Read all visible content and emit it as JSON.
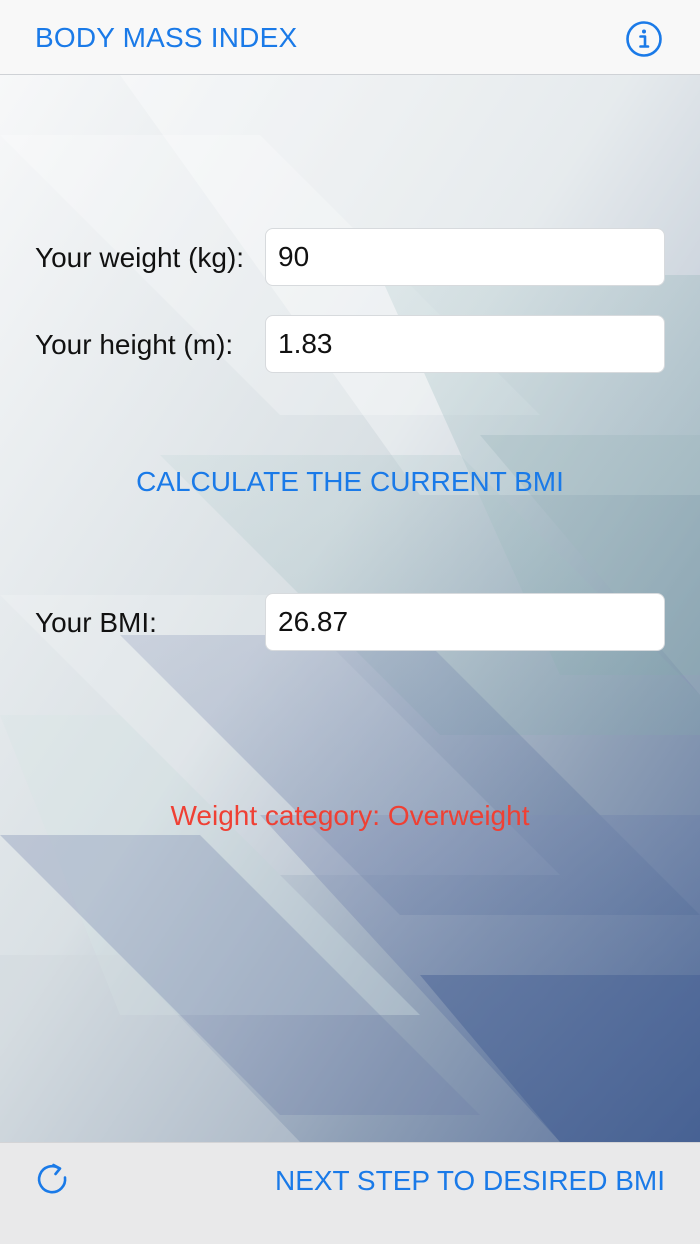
{
  "nav": {
    "title": "BODY MASS INDEX",
    "info_icon": "info-circle-icon"
  },
  "form": {
    "weight_label": "Your weight (kg):",
    "weight_value": "90",
    "height_label": "Your height (m):",
    "height_value": "1.83"
  },
  "actions": {
    "calculate_label": "CALCULATE THE CURRENT BMI"
  },
  "result": {
    "bmi_label": "Your BMI:",
    "bmi_value": "26.87",
    "category_text": "Weight category: Overweight"
  },
  "toolbar": {
    "refresh_icon": "refresh-icon",
    "next_label": "NEXT STEP TO DESIRED BMI"
  },
  "colors": {
    "accent": "#1a7ae8",
    "warning": "#ef4034"
  }
}
